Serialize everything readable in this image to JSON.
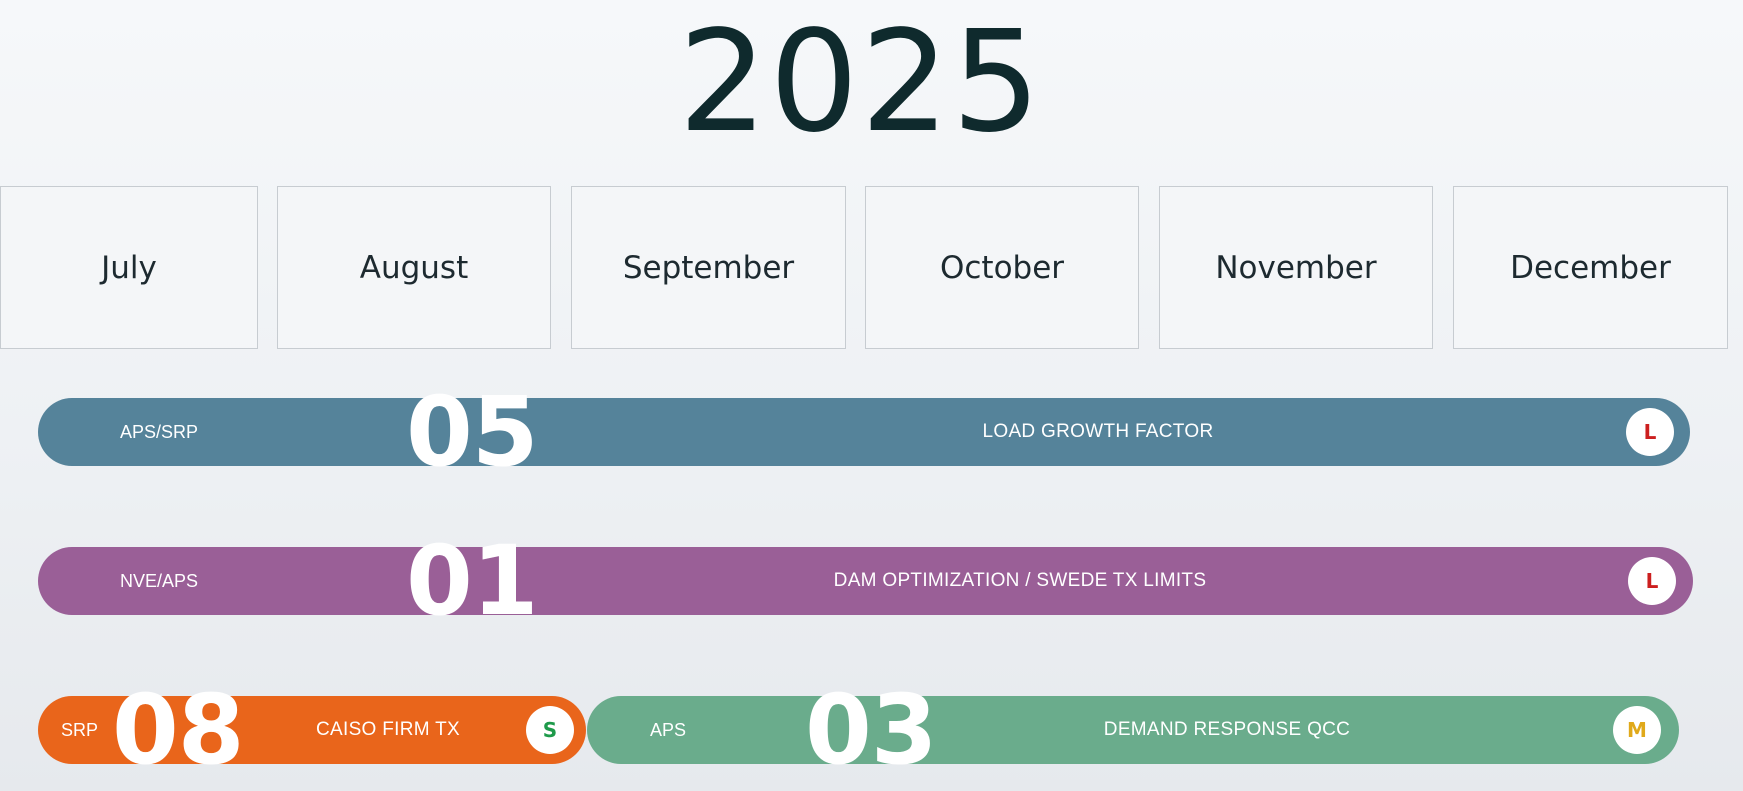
{
  "year": "2025",
  "months": [
    "July",
    "August",
    "September",
    "October",
    "November",
    "December"
  ],
  "bars": {
    "load_growth": {
      "owner": "APS/SRP",
      "number": "05",
      "title": "LOAD GROWTH FACTOR",
      "badge": "L",
      "color": "#55839a",
      "badge_color": "#cc1f1f"
    },
    "dam_optimization": {
      "owner": "NVE/APS",
      "number": "01",
      "title": "DAM OPTIMIZATION / SWEDE TX LIMITS",
      "badge": "L",
      "color": "#9a5f97",
      "badge_color": "#cc1f1f"
    },
    "caiso_firm_tx": {
      "owner": "SRP",
      "number": "08",
      "title": "CAISO FIRM TX",
      "badge": "S",
      "color": "#e9651b",
      "badge_color": "#1e9a4a"
    },
    "demand_response": {
      "owner": "APS",
      "number": "03",
      "title": "DEMAND RESPONSE QCC",
      "badge": "M",
      "color": "#6aac8c",
      "badge_color": "#e0a91a"
    }
  }
}
